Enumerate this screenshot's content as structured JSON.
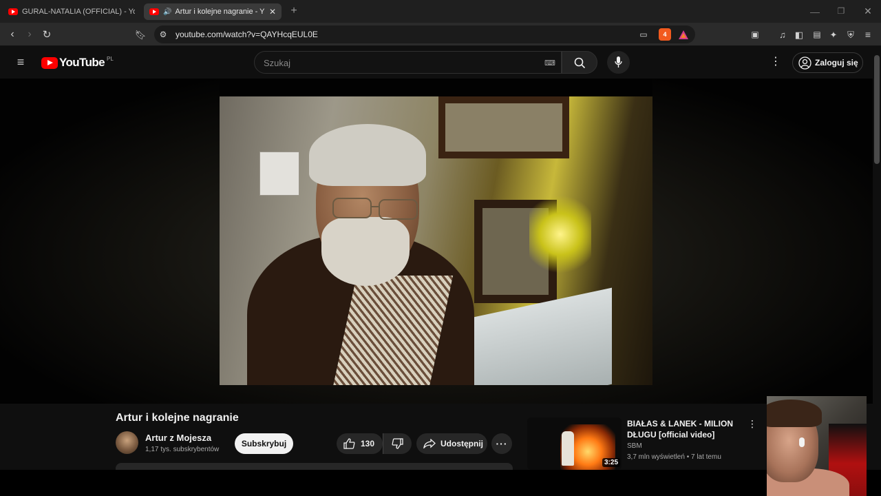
{
  "browser": {
    "tabs": [
      {
        "label": "GURAL-NATALIA (OFFICIAL) - YouTub",
        "active": false
      },
      {
        "label": "Artur i kolejne nagranie - You",
        "active": true,
        "audio_icon": "speaker-icon"
      }
    ],
    "new_tab_symbol": "+",
    "url": "youtube.com/watch?v=QAYHcqEUL0E",
    "brave_badge": "4",
    "window_controls": [
      "minimize-icon",
      "restore-icon",
      "close-icon"
    ]
  },
  "youtube": {
    "logo_text": "YouTube",
    "region": "PL",
    "search_placeholder": "Szukaj",
    "signin_label": "Zaloguj się"
  },
  "video": {
    "title": "Artur i kolejne nagranie",
    "channel": {
      "name": "Artur z Mojesza",
      "subscribers": "1,17 tys. subskrybentów"
    },
    "subscribe_label": "Subskrybuj",
    "likes": "130",
    "share_label": "Udostępnij"
  },
  "recommended": [
    {
      "title": "BIAŁAS & LANEK - MILION DŁUGU [official video]",
      "channel": "SBM",
      "meta": "3,7 mln wyświetleń • 7 lat temu",
      "duration": "3:25"
    }
  ],
  "colors": {
    "youtube_red": "#ff0000",
    "background": "#0f0f0f",
    "chrome": "#1f1f1f"
  }
}
